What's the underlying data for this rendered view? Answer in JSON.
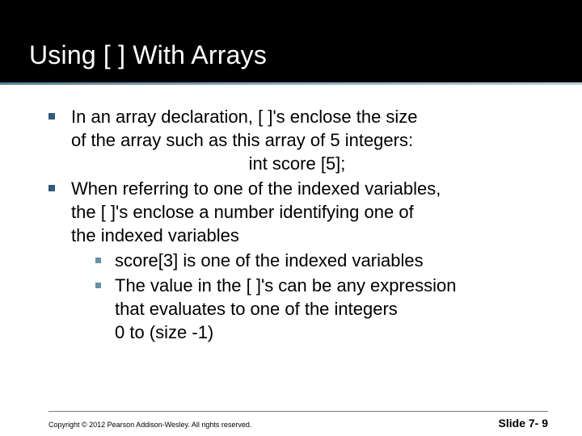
{
  "title": "Using [ ] With Arrays",
  "bullets": [
    {
      "text_line1": "In an array declaration, [ ]'s enclose the size",
      "text_line2": "of the array such as this array of 5 integers:",
      "code": "int score [5];"
    },
    {
      "text_line1": "When referring to one of the indexed variables,",
      "text_line2": "the [ ]'s enclose a number identifying one of",
      "text_line3": "the indexed variables",
      "sub": [
        {
          "text": "score[3] is one of the indexed variables"
        },
        {
          "line1": "The value in the [ ]'s can be any expression",
          "line2": "that evaluates to one of the integers",
          "line3": "0 to (size -1)"
        }
      ]
    }
  ],
  "footer": {
    "copyright": "Copyright © 2012 Pearson Addison-Wesley. All rights reserved.",
    "page": "Slide 7- 9"
  }
}
